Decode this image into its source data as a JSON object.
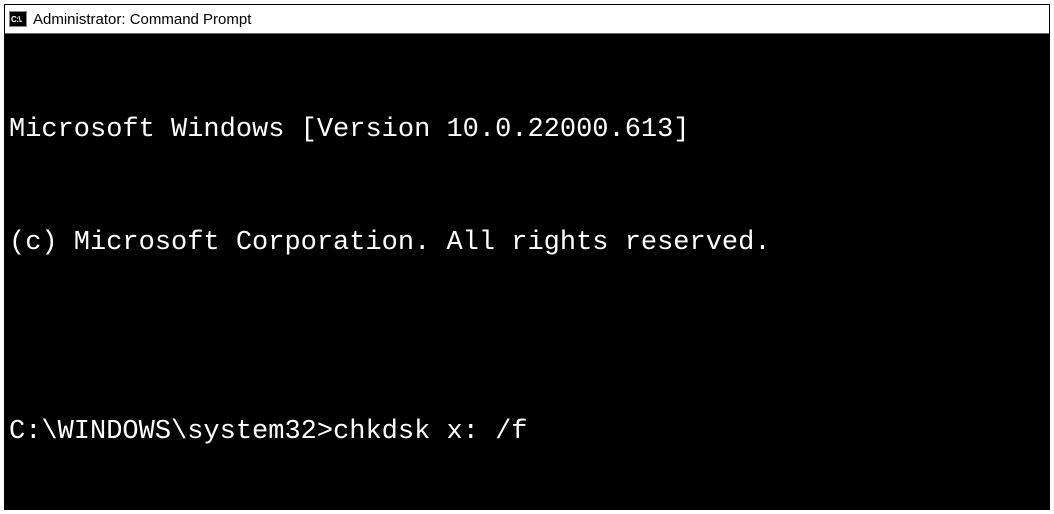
{
  "window": {
    "icon_label": "C:\\.",
    "title": "Administrator: Command Prompt"
  },
  "terminal": {
    "line1": "Microsoft Windows [Version 10.0.22000.613]",
    "line2": "(c) Microsoft Corporation. All rights reserved.",
    "blank": "",
    "prompt": "C:\\WINDOWS\\system32>",
    "command": "chkdsk x: /f"
  }
}
